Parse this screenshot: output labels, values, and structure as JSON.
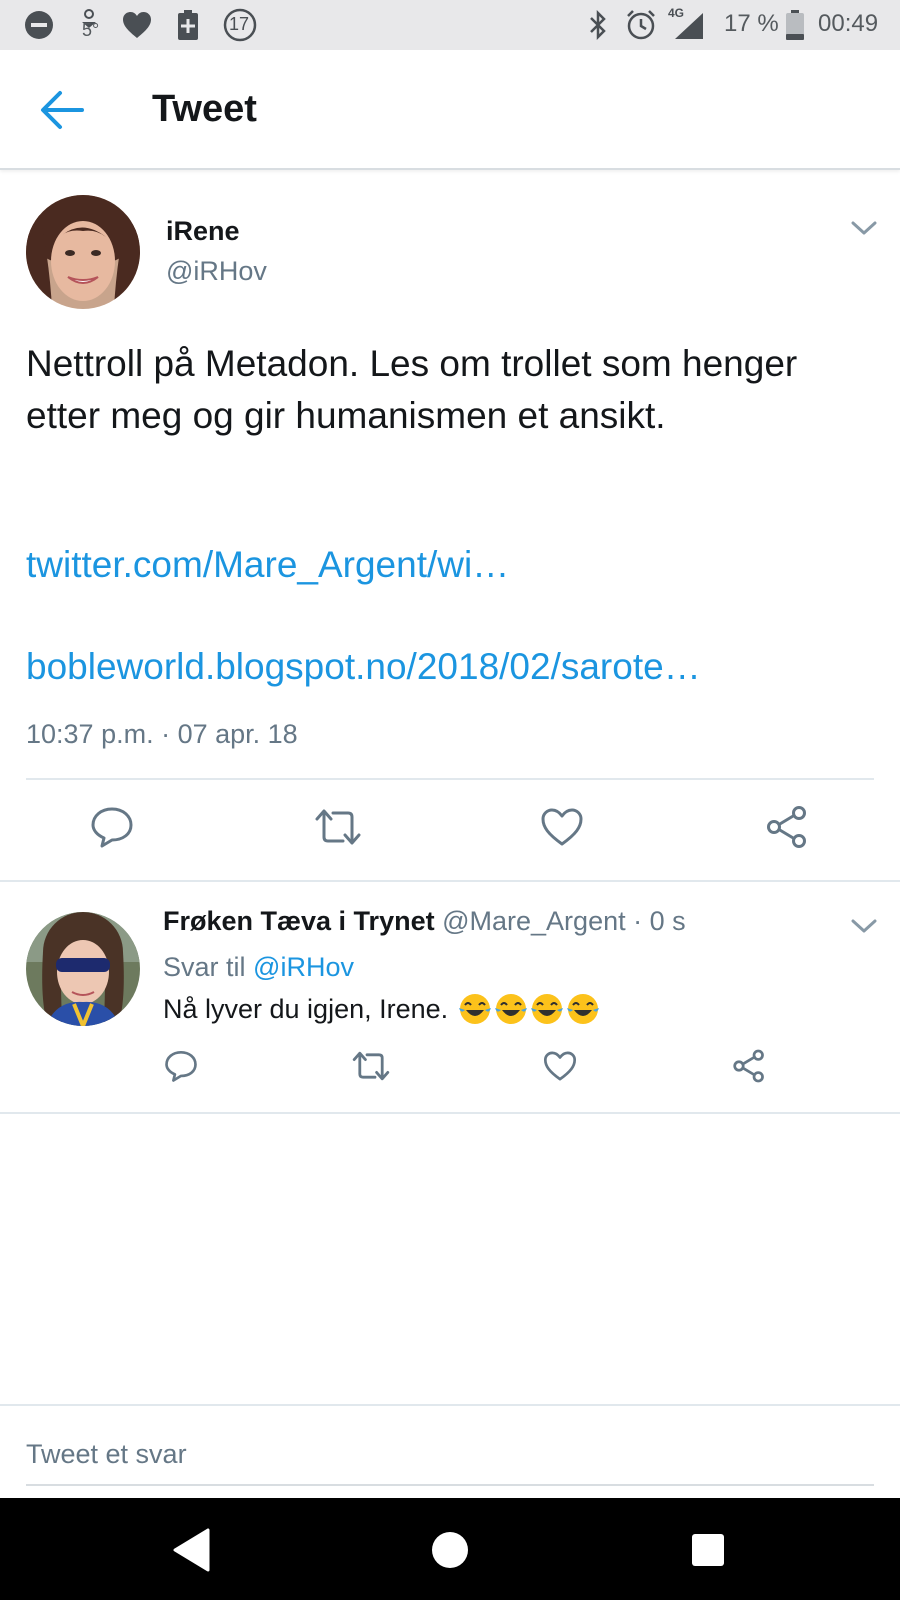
{
  "status_bar": {
    "notification_count": "17",
    "temperature": "5",
    "temperature_unit": "°",
    "network": "4G",
    "battery_percent": "17 %",
    "time": "00:49"
  },
  "header": {
    "title": "Tweet"
  },
  "main_tweet": {
    "display_name": "iRene",
    "handle": "@iRHov",
    "text": "Nettroll på Metadon. Les om trollet som henger etter meg og gir humanismen et ansikt.",
    "links": [
      "twitter.com/Mare_Argent/wi…",
      "bobleworld.blogspot.no/2018/02/sarote…"
    ],
    "timestamp": "10:37 p.m. · 07 apr. 18"
  },
  "reply": {
    "display_name": "Frøken Tæva i Trynet",
    "handle_time": "@Mare_Argent · 0 s",
    "reply_to_label": "Svar til",
    "reply_to_handle": "@iRHov",
    "text": "Nå lyver du igjen, Irene.",
    "emoji": [
      "face-with-tears-of-joy",
      "face-with-tears-of-joy",
      "face-with-tears-of-joy",
      "face-with-tears-of-joy"
    ]
  },
  "compose": {
    "placeholder": "Tweet et svar"
  },
  "colors": {
    "accent": "#1b95e0",
    "text_primary": "#14171a",
    "text_secondary": "#657786",
    "divider": "#e1e8ed",
    "status_bar_bg": "#e8e8ea",
    "nav_bar_bg": "#000000"
  },
  "icons": {
    "status_left": [
      "dnd-icon",
      "weather-icon",
      "heart-icon",
      "battery-plus-icon",
      "notification-count-icon"
    ],
    "status_right": [
      "bluetooth-icon",
      "alarm-icon",
      "signal-icon",
      "battery-icon"
    ],
    "actions": [
      "reply-icon",
      "retweet-icon",
      "like-icon",
      "share-icon"
    ],
    "nav": [
      "nav-back-icon",
      "nav-home-icon",
      "nav-recents-icon"
    ]
  }
}
